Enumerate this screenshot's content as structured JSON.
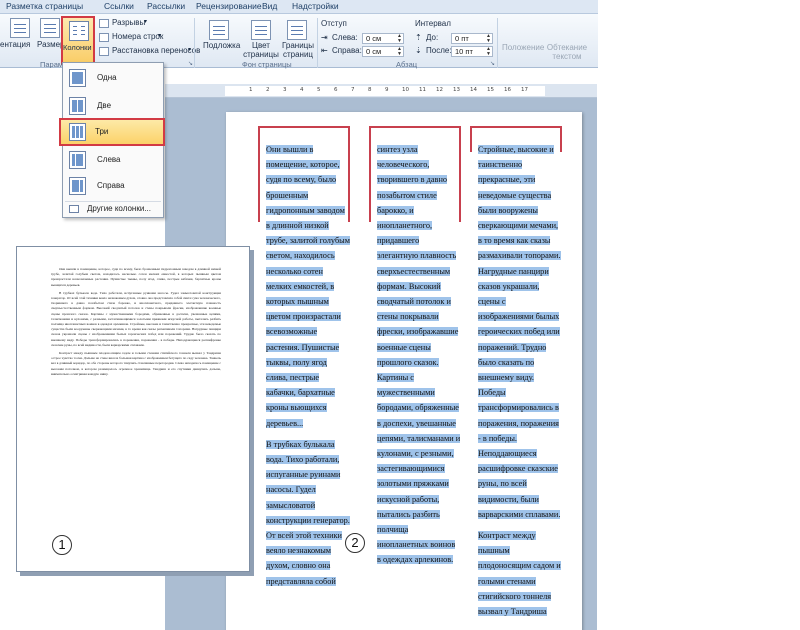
{
  "ribbon": {
    "tabs": [
      "Разметка страницы",
      "Ссылки",
      "Рассылки",
      "Рецензирование",
      "Вид",
      "Надстройки"
    ],
    "page_setup": {
      "orientation_label": "ентация",
      "size_label": "Размер",
      "columns_label": "Колонки",
      "breaks_label": "Разрывы",
      "line_numbers_label": "Номера строк",
      "hyphenation_label": "Расстановка переносов",
      "group_label": "Парамет"
    },
    "page_background": {
      "watermark_label": "Подложка",
      "page_color_label_line1": "Цвет",
      "page_color_label_line2": "страницы",
      "page_borders_label_line1": "Границы",
      "page_borders_label_line2": "страниц",
      "group_label": "Фон страницы"
    },
    "paragraph": {
      "indent_label": "Отступ",
      "left_label": "Слева:",
      "left_value": "0 см",
      "right_label": "Справа:",
      "right_value": "0 см",
      "spacing_label": "Интервал",
      "before_label": "До:",
      "before_value": "0 пт",
      "after_label": "После:",
      "after_value": "10 пт",
      "group_label": "Абзац"
    },
    "arrange": {
      "position_label": "Положение",
      "wrap_label_line1": "Обтекание",
      "wrap_label_line2": "текстом"
    }
  },
  "columns_menu": {
    "items": [
      {
        "label": "Одна"
      },
      {
        "label": "Две"
      },
      {
        "label": "Три",
        "selected": true
      },
      {
        "label": "Слева"
      },
      {
        "label": "Справа"
      }
    ],
    "more_label": "Другие колонки..."
  },
  "ruler": {
    "marks": [
      "1",
      "2",
      "3",
      "4",
      "5",
      "6",
      "7",
      "8",
      "9",
      "10",
      "11",
      "12",
      "13",
      "14",
      "15",
      "16",
      "17"
    ]
  },
  "callouts": {
    "one": "1",
    "two": "2"
  },
  "document": {
    "column1": {
      "p1": "Они вышли в помещение, которое, судя по всему, было брошенным гидропонным заводом в длинной низкой трубе, залитой голубым светом, находилось несколько сотен мелких емкостей, в которых пышным цветом произрастали всевозможные растения. Пушистые тыквы, полу ягод слива, пестрые кабачки, бархатные кроны вьющихся деревьев...",
      "p2": "В трубках булькала вода. Тихо работали, испуганные руинами насосы. Гудел замысловатой конструкции генератор. От всей этой техники веяло незнакомым духом, словно она представляла собой"
    },
    "column2": {
      "p1": "синтез узла человеческого, творившего в давно позабытом стиле барокко, и инопланетного, придавшего элегантную плавность сверхъестественным формам. Высокий сводчатый потолок и стены покрывали фрески, изображавшие военные сцены прошлого сказок. Картины с мужественными бородами, обряженные в доспехи, увешанные цепями, талисманами и кулонами, с резными, застегивающимися золотыми пряжками искусной работы, пытались разбить полчища инопланетных воинов в одеждах арлекинов."
    },
    "column3": {
      "p1": "Стройные, высокие и таинственно прекрасные, эти неведомые существа были вооружены сверкающими мечами, в то время как сказы размахивали топорами. Нагрудные панцири сказов украшали, сцены с изображениями былых героических побед или поражений. Трудно было сказать по внешнему виду. Победы трансформировались в поражения, поражения - в победы. Неподдающиеся расшифровке сказские руны, по всей видимости, были варварскими сплавами.",
      "p2": "Контраст между пышным плодоносящим садом и голыми стенами стигийского тоннеля вызвал у Тандриша"
    }
  },
  "thumbnail": {
    "paragraphs": [
      "Они вышли в помещение, которое, судя по всему, было брошенным гидропонным заводом в длинной низкой трубе, залитой голубым светом, находилось несколько сотен мелких емкостей, в которых пышным цветом произрастали всевозможные растения. Пушистые тыквы, полу ягод, слива, пестрые кабачки, бархатные кроны вьющихся деревьев.",
      "В трубках булькала вода. Тихо работали, испуганные руинами насосы. Гудел замысловатой конструкции генератор. От всей этой техники веяло незнакомым духом, словно она представляла собой синтез ума человеческого, творившего в давно позабытом стиле барокко, и инопланетного, придавшего элегантную плавность сверхъестественным формам. Высокий сводчатый потолок и стены покрывали фрески, изображавшие военные сцены прошлого сказок. Картины с мужественными бородами, обряженные в доспехи, увешанные цепями, талисманами и кулонами, с резными, застегивающимися золотыми пряжками искусной работы, пытались разбить полчища инопланетных воинов в одеждах арлекинов. Стройные, высокие и таинственно прекрасные, эти неведомые существа были вооружены сверкающими мечами, в то время как сказы размахивали топорами. Нагрудные панцири сказов украшали сцены с изображениями былых героических побед или поражений. Трудно было сказать по внешнему виду. Победы трансформировались в поражения, поражения - в победы. Неподдающиеся расшифровке сказские руны, по всей видимости, были варварскими сплавами.",
      "Контраст между пышным плодоносящим садом и голыми стенами стигийского тоннеля вызвал у Тандриша острое чувство тоски. Дальше на стене висела большая картина с изображением бегущего по саду человека. Тоннель вел в длинный коридор, по обе стороны которого тянулись стеклянные перегородки. Слева находилось помещение с высоким потолком, в котором размещалось огромное хранилище. Тандриш и его спутники двинулись дальше, внимательно осматривая каждую нишу."
    ]
  },
  "colors": {
    "accent_red": "#d23a44",
    "selection_blue": "#9fc3ea",
    "ribbon_blue": "#dde7f3"
  }
}
